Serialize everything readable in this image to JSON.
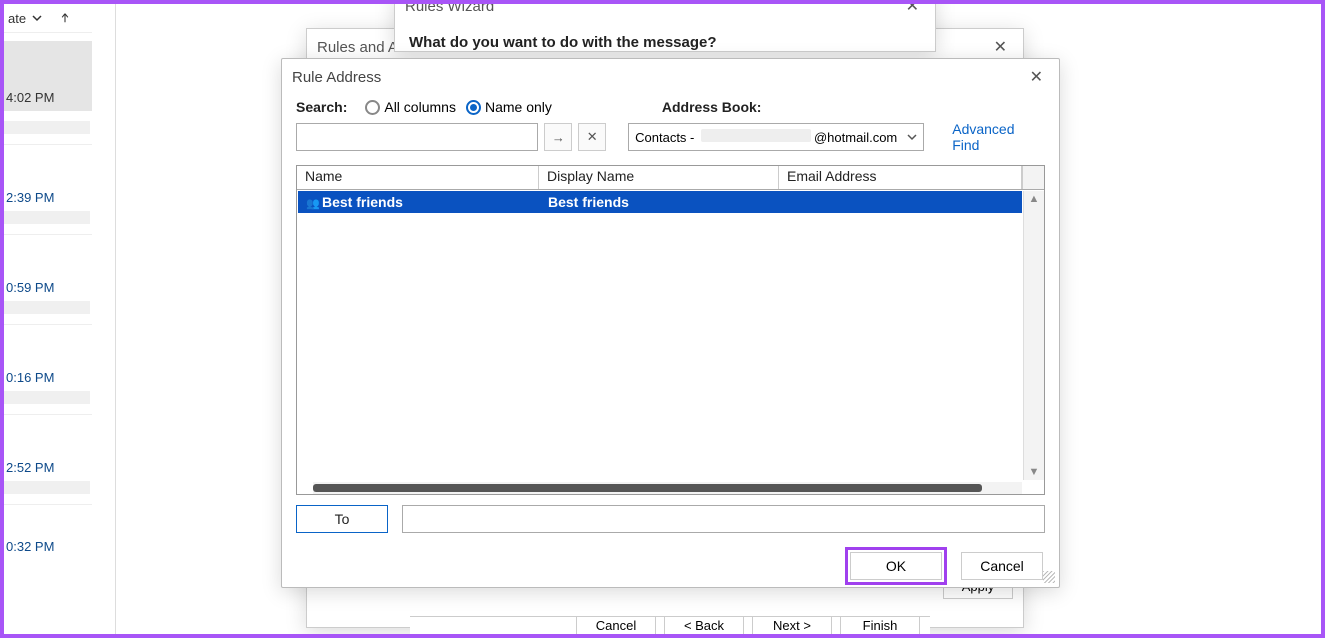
{
  "mail": {
    "header_fragment": "ate",
    "times": [
      "4:02 PM",
      "2:39 PM",
      "0:59 PM",
      "0:16 PM",
      "2:52 PM",
      "0:32 PM"
    ]
  },
  "rules_wizard": {
    "title": "Rules Wizard",
    "prompt": "What do you want to do with the message?",
    "buttons": {
      "cancel": "Cancel",
      "back": "< Back",
      "next": "Next >",
      "finish": "Finish"
    }
  },
  "rules_alerts": {
    "title_fragment": "Rules and A",
    "apply": "Apply"
  },
  "rule_address": {
    "title": "Rule Address",
    "search_label": "Search:",
    "radio_all": "All columns",
    "radio_name": "Name only",
    "selected_radio": "name",
    "ab_label": "Address Book:",
    "ab_prefix": "Contacts - ",
    "ab_suffix": "@hotmail.com",
    "advanced_find": "Advanced Find",
    "columns": {
      "name": "Name",
      "display": "Display Name",
      "email": "Email Address"
    },
    "rows": [
      {
        "name": "Best friends",
        "display": "Best friends",
        "email": "",
        "selected": true
      }
    ],
    "to_button": "To",
    "to_value": "",
    "ok": "OK",
    "cancel": "Cancel"
  }
}
